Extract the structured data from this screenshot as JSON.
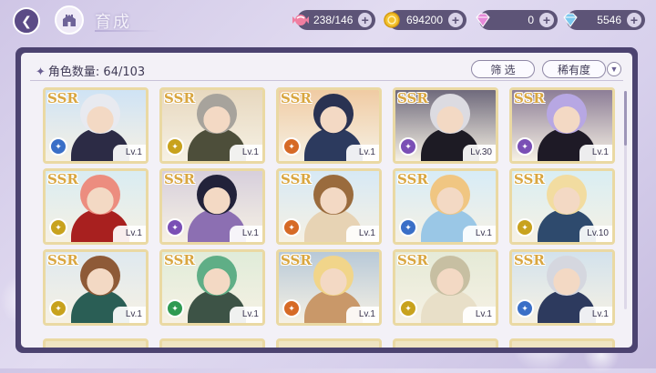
{
  "header": {
    "title": "育成",
    "back_icon": "back-arrow-icon",
    "home_icon": "castle-home-icon"
  },
  "resources": [
    {
      "name": "stamina",
      "icon": "candy-icon",
      "value": "238/146",
      "color": "#f07ea0"
    },
    {
      "name": "gold",
      "icon": "coin-icon",
      "value": "694200",
      "color": "#f2c12e"
    },
    {
      "name": "pink-gem",
      "icon": "pink-diamond-icon",
      "value": "0",
      "color": "#e58ad9"
    },
    {
      "name": "blue-gem",
      "icon": "blue-diamond-icon",
      "value": "5546",
      "color": "#7cc8ee"
    }
  ],
  "panel": {
    "count_label": "角色数量: 64/103",
    "filter_label": "筛 选",
    "sort_label": "稀有度"
  },
  "cards": [
    {
      "rarity": "SSR",
      "level": "Lv.1",
      "attr_color": "#3a6fc7",
      "hair": "#e8eaf0",
      "bg": "#cfe3f5",
      "body": "#2c2b45"
    },
    {
      "rarity": "SSR",
      "level": "Lv.1",
      "attr_color": "#c8a21d",
      "hair": "#a7a39c",
      "bg": "#e7d8bf",
      "body": "#4d4e3a"
    },
    {
      "rarity": "SSR",
      "level": "Lv.1",
      "attr_color": "#d66a26",
      "hair": "#2a3252",
      "bg": "#f0cba3",
      "body": "#2c3a5e"
    },
    {
      "rarity": "SSR",
      "level": "Lv.30",
      "attr_color": "#7a4fb5",
      "hair": "#dcdbe1",
      "bg": "#6f6a7c",
      "body": "#1d1b24"
    },
    {
      "rarity": "SSR",
      "level": "Lv.1",
      "attr_color": "#7a4fb5",
      "hair": "#b7a7e3",
      "bg": "#8d7e97",
      "body": "#1e1a26"
    },
    {
      "rarity": "SSR",
      "level": "Lv.1",
      "attr_color": "#c8a21d",
      "hair": "#ec8d7f",
      "bg": "#d9ecf2",
      "body": "#a8201f"
    },
    {
      "rarity": "SSR",
      "level": "Lv.1",
      "attr_color": "#7a4fb5",
      "hair": "#22223a",
      "bg": "#d7cfdc",
      "body": "#8c6fb2"
    },
    {
      "rarity": "SSR",
      "level": "Lv.1",
      "attr_color": "#d66a26",
      "hair": "#9a6b3d",
      "bg": "#d7e9f5",
      "body": "#e7d3b4"
    },
    {
      "rarity": "SSR",
      "level": "Lv.1",
      "attr_color": "#3a6fc7",
      "hair": "#f0c682",
      "bg": "#d7ecf7",
      "body": "#9ac7e6"
    },
    {
      "rarity": "SSR",
      "level": "Lv.10",
      "attr_color": "#c8a21d",
      "hair": "#f2dca0",
      "bg": "#d9eef3",
      "body": "#2e4a6d"
    },
    {
      "rarity": "SSR",
      "level": "Lv.1",
      "attr_color": "#c8a21d",
      "hair": "#8e5a37",
      "bg": "#dfe9ef",
      "body": "#2a5e55"
    },
    {
      "rarity": "SSR",
      "level": "Lv.1",
      "attr_color": "#2f9a52",
      "hair": "#5fae86",
      "bg": "#e0ecd9",
      "body": "#3d5346"
    },
    {
      "rarity": "SSR",
      "level": "Lv.1",
      "attr_color": "#d66a26",
      "hair": "#f1d58a",
      "bg": "#b8c9d8",
      "body": "#c99869"
    },
    {
      "rarity": "SSR",
      "level": "Lv.1",
      "attr_color": "#c8a21d",
      "hair": "#c7bfa2",
      "bg": "#e5ead7",
      "body": "#e8dfc8"
    },
    {
      "rarity": "SSR",
      "level": "Lv.1",
      "attr_color": "#3a6fc7",
      "hair": "#d5d7df",
      "bg": "#d3e2ec",
      "body": "#2d3a5e"
    }
  ]
}
